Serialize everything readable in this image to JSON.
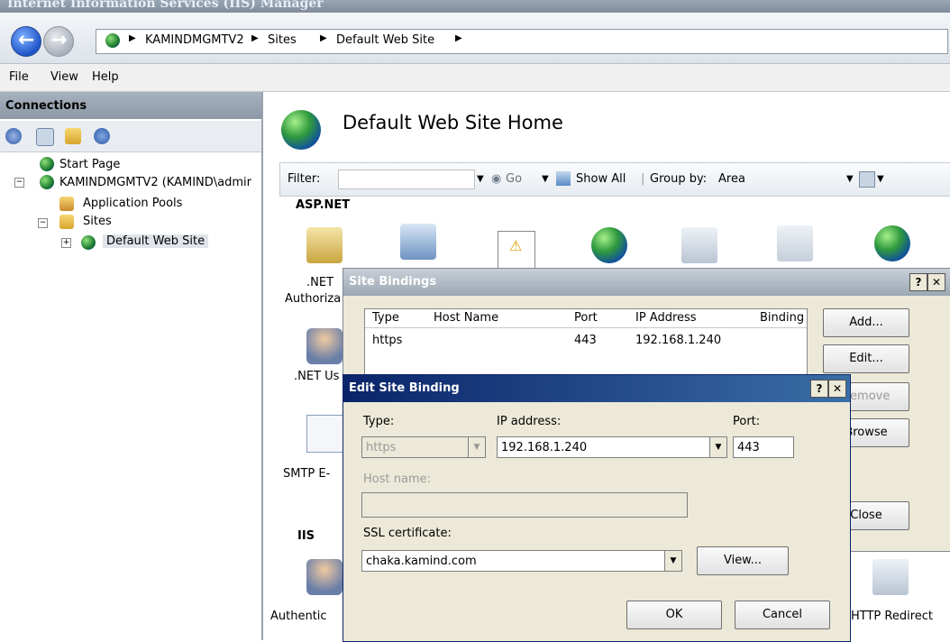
{
  "window": {
    "title": "Internet Information Services (IIS) Manager"
  },
  "breadcrumb": {
    "items": [
      "KAMINDMGMTV2",
      "Sites",
      "Default Web Site"
    ]
  },
  "menu": {
    "items": [
      "File",
      "View",
      "Help"
    ]
  },
  "connections": {
    "header": "Connections",
    "tree": [
      {
        "label": "Start Page"
      },
      {
        "label": "KAMINDMGMTV2 (KAMIND\\admir"
      },
      {
        "label": "Application Pools"
      },
      {
        "label": "Sites"
      },
      {
        "label": "Default Web Site"
      }
    ]
  },
  "main": {
    "title": "Default Web Site Home",
    "filter": {
      "label": "Filter:",
      "go": "Go",
      "show_all": "Show All",
      "group_by_label": "Group by:",
      "group_by_value": "Area"
    },
    "sections": {
      "aspnet": "ASP.NET",
      "iis": "IIS"
    },
    "features": [
      ".NET Authoriz",
      ".NET Us",
      "SMTP E-",
      "Authentic",
      "HTTP Redirect"
    ],
    "feature_lines": {
      "net_auth_1": ".NET",
      "net_auth_2": "Authoriza"
    }
  },
  "site_bindings": {
    "title": "Site Bindings",
    "columns": [
      "Type",
      "Host Name",
      "Port",
      "IP Address",
      "Binding"
    ],
    "rows": [
      {
        "type": "https",
        "host": "",
        "port": "443",
        "ip": "192.168.1.240"
      }
    ],
    "buttons": {
      "add": "Add...",
      "edit": "Edit...",
      "remove": "Remove",
      "browse": "Browse",
      "close": "Close"
    }
  },
  "edit_binding": {
    "title": "Edit Site Binding",
    "type_label": "Type:",
    "type_value": "https",
    "ip_label": "IP address:",
    "ip_value": "192.168.1.240",
    "port_label": "Port:",
    "port_value": "443",
    "host_label": "Host name:",
    "host_value": "",
    "ssl_label": "SSL certificate:",
    "ssl_value": "chaka.kamind.com",
    "view_button": "View...",
    "ok_button": "OK",
    "cancel_button": "Cancel"
  }
}
